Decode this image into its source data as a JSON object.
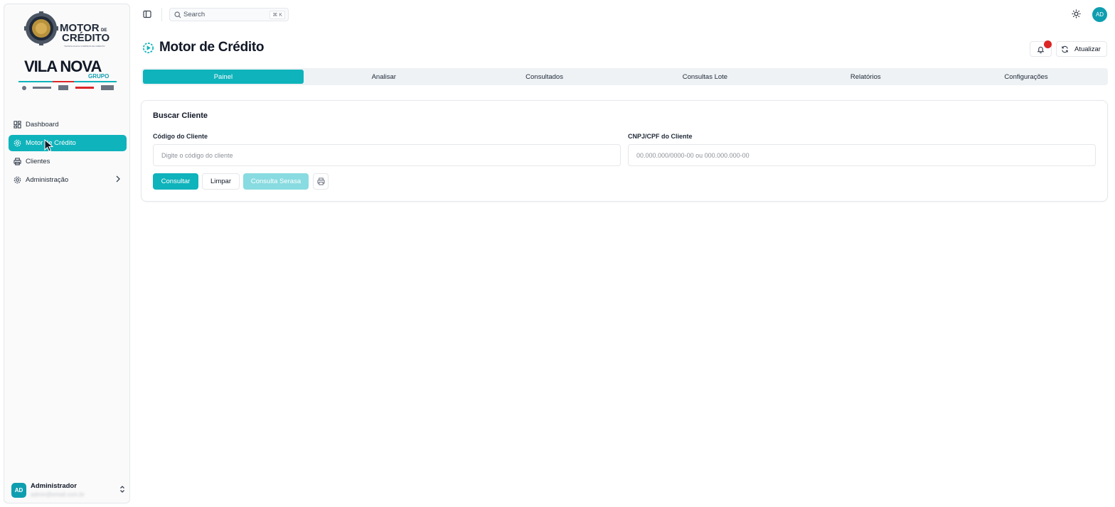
{
  "sidebar": {
    "logo": {
      "brand_line1": "MOTOR",
      "brand_de": "DE",
      "brand_line2": "CRÉDITO",
      "brand_tagline": "TECNOLOGIA E COMPRAS DE CRÉDITO",
      "group_name": "VILA NOVA",
      "group_sub": "GRUPO"
    },
    "items": [
      {
        "label": "Dashboard",
        "icon": "dashboard-icon"
      },
      {
        "label": "Motor de Crédito",
        "icon": "gear-icon"
      },
      {
        "label": "Clientes",
        "icon": "printer-icon"
      },
      {
        "label": "Administração",
        "icon": "gear-icon"
      }
    ],
    "active_index": 1,
    "user": {
      "initials": "AD",
      "name": "Administrador",
      "email": "admin@email.com.br"
    }
  },
  "topbar": {
    "search_placeholder": "Search",
    "search_shortcut": "⌘ K",
    "avatar_initials": "AD"
  },
  "page": {
    "title": "Motor de Crédito",
    "refresh_label": "Atualizar"
  },
  "tabs": [
    {
      "label": "Painel"
    },
    {
      "label": "Analisar"
    },
    {
      "label": "Consultados"
    },
    {
      "label": "Consultas Lote"
    },
    {
      "label": "Relatórios"
    },
    {
      "label": "Configurações"
    }
  ],
  "active_tab": 0,
  "card": {
    "title": "Buscar Cliente",
    "code_label": "Código do Cliente",
    "code_placeholder": "Digite o código do cliente",
    "code_value": "",
    "doc_label": "CNPJ/CPF do Cliente",
    "doc_placeholder": "00.000.000/0000-00 ou 000.000.000-00",
    "doc_value": "",
    "consultar_label": "Consultar",
    "limpar_label": "Limpar",
    "serasa_label": "Consulta Serasa"
  },
  "colors": {
    "accent": "#0fb3bb",
    "accent_disabled": "#88dbe0",
    "badge": "#dc2626",
    "avatar": "#0e9eb0"
  }
}
